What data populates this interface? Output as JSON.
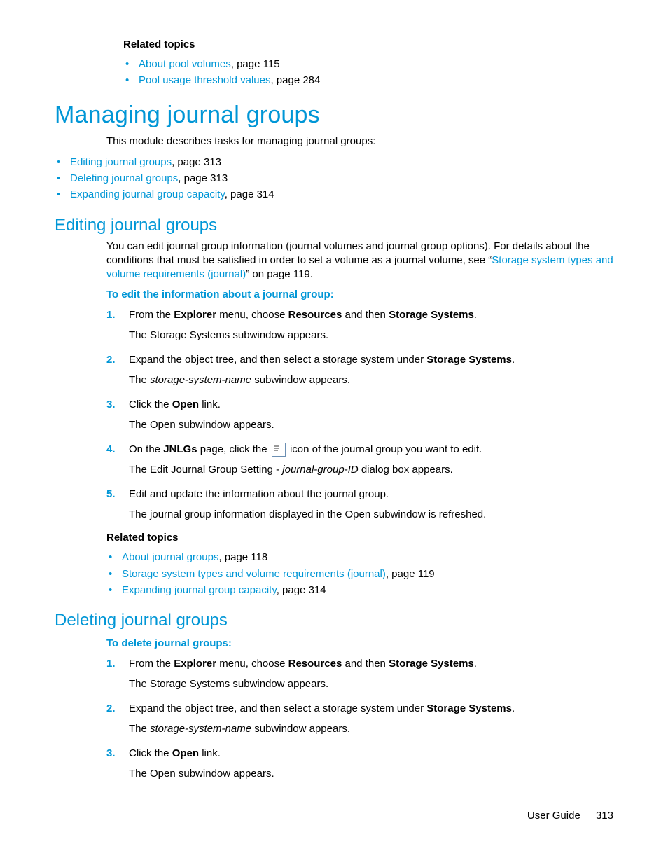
{
  "topRelated": {
    "heading": "Related topics",
    "items": [
      {
        "link": "About pool volumes",
        "tail": ", page 115"
      },
      {
        "link": "Pool usage threshold values",
        "tail": ", page 284"
      }
    ]
  },
  "mainTitle": "Managing journal groups",
  "intro": "This module describes tasks for managing journal groups:",
  "introBullets": [
    {
      "link": "Editing journal groups",
      "tail": ", page 313"
    },
    {
      "link": "Deleting journal groups",
      "tail": ", page 313"
    },
    {
      "link": "Expanding journal group capacity",
      "tail": ", page 314"
    }
  ],
  "editing": {
    "title": "Editing journal groups",
    "para_pre": "You can edit journal group information (journal volumes and journal group options). For details about the conditions that must be satisfied in order to set a volume as a journal volume, see “",
    "para_link": "Storage system types and volume requirements (journal)",
    "para_post": "” on page 119.",
    "procTitle": "To edit the information about a journal group:",
    "steps": [
      {
        "pre": "From the ",
        "b1": "Explorer",
        "mid1": " menu, choose ",
        "b2": "Resources",
        "mid2": " and then ",
        "b3": "Storage Systems",
        "post": ".",
        "sub": "The Storage Systems subwindow appears."
      },
      {
        "pre": "Expand the object tree, and then select a storage system under ",
        "b1": "Storage Systems",
        "post": ".",
        "sub_pre": "The ",
        "sub_i": "storage-system-name",
        "sub_post": " subwindow appears."
      },
      {
        "pre": "Click the ",
        "b1": "Open",
        "post": " link.",
        "sub": "The Open subwindow appears."
      },
      {
        "pre": "On the ",
        "b1": "JNLGs",
        "mid1": " page, click the ",
        "post": " icon of the journal group you want to edit.",
        "sub_pre": "The Edit Journal Group Setting - ",
        "sub_i": "journal-group-ID",
        "sub_post": " dialog box appears."
      },
      {
        "pre": "Edit and update the information about the journal group.",
        "sub": "The journal group information displayed in the Open subwindow is refreshed."
      }
    ],
    "related": {
      "heading": "Related topics",
      "items": [
        {
          "link": "About journal groups",
          "tail": ", page 118"
        },
        {
          "link": "Storage system types and volume requirements (journal)",
          "tail": ", page 119"
        },
        {
          "link": "Expanding journal group capacity",
          "tail": ", page 314"
        }
      ]
    }
  },
  "deleting": {
    "title": "Deleting journal groups",
    "procTitle": "To delete journal groups:",
    "steps": [
      {
        "pre": "From the ",
        "b1": "Explorer",
        "mid1": " menu, choose ",
        "b2": "Resources",
        "mid2": " and then ",
        "b3": "Storage Systems",
        "post": ".",
        "sub": "The Storage Systems subwindow appears."
      },
      {
        "pre": "Expand the object tree, and then select a storage system under ",
        "b1": "Storage Systems",
        "post": ".",
        "sub_pre": "The ",
        "sub_i": "storage-system-name",
        "sub_post": " subwindow appears."
      },
      {
        "pre": "Click the ",
        "b1": "Open",
        "post": " link.",
        "sub": "The Open subwindow appears."
      }
    ]
  },
  "footer": {
    "label": "User Guide",
    "page": "313"
  }
}
